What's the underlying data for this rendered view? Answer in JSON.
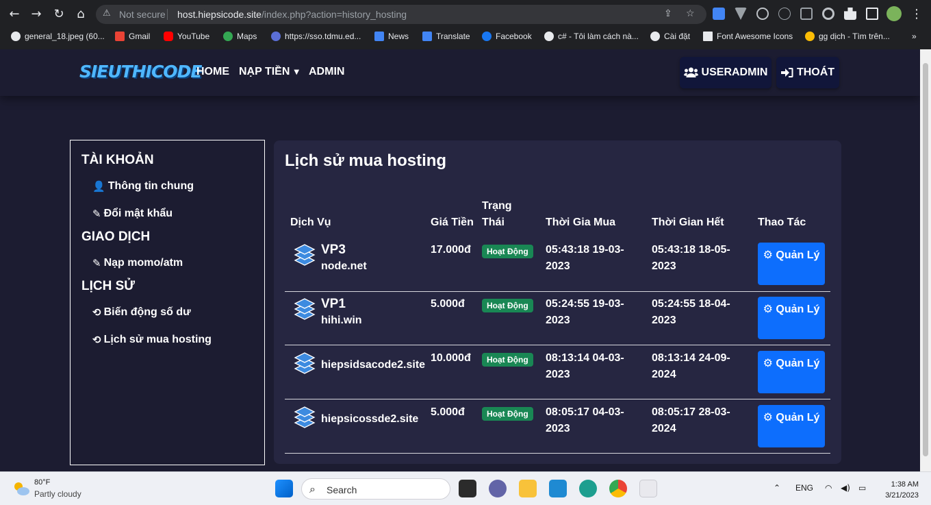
{
  "browser": {
    "url_warning": "Not secure",
    "url_host": "host.hiepsicode.site",
    "url_path": "/index.php?action=history_hosting",
    "bookmarks": [
      {
        "label": "general_18.jpeg (60...",
        "color": "#e8eaed"
      },
      {
        "label": "Gmail",
        "color": "#ea4335"
      },
      {
        "label": "YouTube",
        "color": "#ff0000"
      },
      {
        "label": "Maps",
        "color": "#34a853"
      },
      {
        "label": "https://sso.tdmu.ed...",
        "color": "#5b6fd6"
      },
      {
        "label": "News",
        "color": "#4285f4"
      },
      {
        "label": "Translate",
        "color": "#4285f4"
      },
      {
        "label": "Facebook",
        "color": "#1877f2"
      },
      {
        "label": "c# - Tôi làm cách nà...",
        "color": "#e8eaed"
      },
      {
        "label": "Cài đặt",
        "color": "#e8eaed"
      },
      {
        "label": "Font Awesome Icons",
        "color": "#e8eaed"
      },
      {
        "label": "gg dịch - Tìm trên...",
        "color": "#e8eaed"
      }
    ],
    "bookmarks_overflow": "»"
  },
  "site": {
    "logo_text": "SIEUTHICODE",
    "menu": {
      "home": "HOME",
      "topup": "NẠP TIỀN",
      "admin": "ADMIN"
    },
    "user_button": "USERADMIN",
    "logout_button": "THOÁT"
  },
  "sidebar": {
    "account_heading": "TÀI KHOẢN",
    "account_items": [
      "Thông tin chung",
      "Đổi mật khẩu"
    ],
    "transaction_heading": "GIAO DỊCH",
    "transaction_items": [
      "Nạp momo/atm"
    ],
    "history_heading": "LỊCH SỬ",
    "history_items": [
      "Biến động số dư",
      "Lịch sử mua hosting"
    ]
  },
  "history": {
    "title": "Lịch sử mua hosting",
    "columns": [
      "Dịch Vụ",
      "Giá Tiền",
      "Trạng Thái",
      "Thời Gia Mua",
      "Thời Gian Hết",
      "Thao Tác"
    ],
    "status_label": "Hoạt Động",
    "action_label": "Quản Lý",
    "rows": [
      {
        "plan": "VP3",
        "domain": "node.net",
        "price": "17.000đ",
        "bought": "05:43:18 19-03-2023",
        "expires": "05:43:18 18-05-2023"
      },
      {
        "plan": "VP1",
        "domain": "hihi.win",
        "price": "5.000đ",
        "bought": "05:24:55 19-03-2023",
        "expires": "05:24:55 18-04-2023"
      },
      {
        "plan": "",
        "domain": "hiepsidsacode2.site",
        "price": "10.000đ",
        "bought": "08:13:14 04-03-2023",
        "expires": "08:13:14 24-09-2024"
      },
      {
        "plan": "",
        "domain": "hiepsicossde2.site",
        "price": "5.000đ",
        "bought": "08:05:17 04-03-2023",
        "expires": "08:05:17 28-03-2024"
      }
    ]
  },
  "taskbar": {
    "temperature": "80°F",
    "weather": "Partly cloudy",
    "search": "Search",
    "language": "ENG",
    "time": "1:38 AM",
    "date": "3/21/2023"
  }
}
